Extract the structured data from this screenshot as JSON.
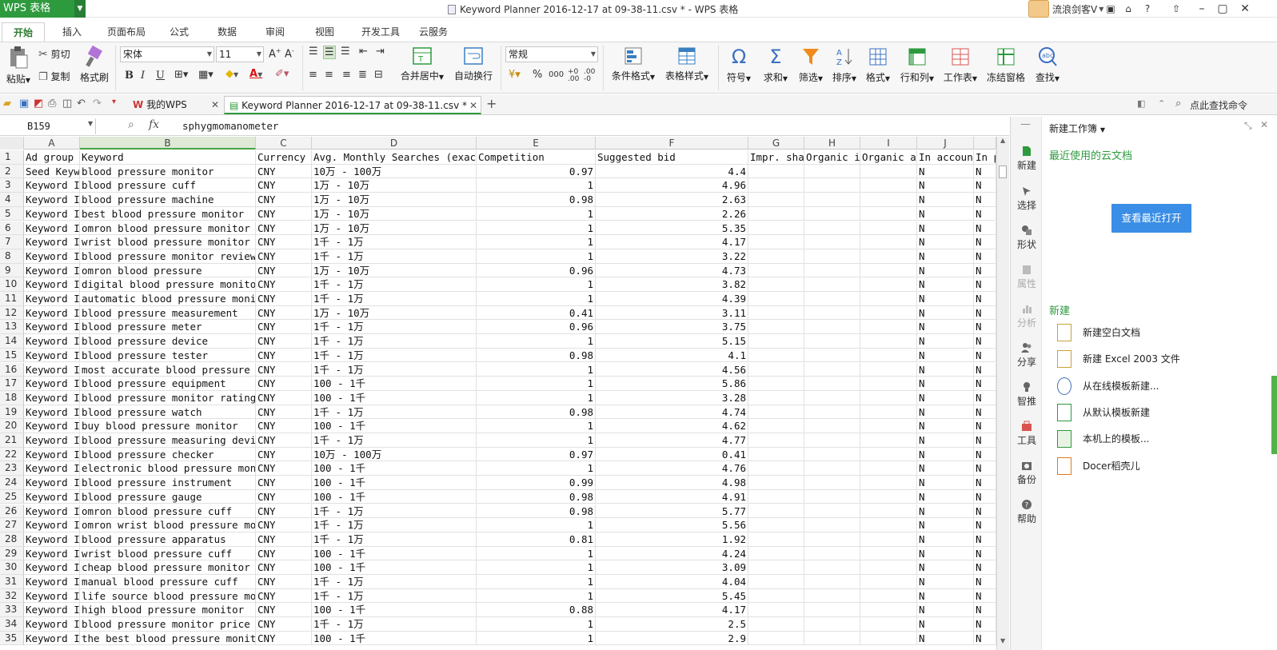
{
  "app": {
    "logo": "WPS 表格",
    "title": "Keyword Planner 2016-12-17 at 09-38-11.csv * - WPS 表格",
    "user": "流浪剑客V"
  },
  "ribbon_tabs": [
    "开始",
    "插入",
    "页面布局",
    "公式",
    "数据",
    "审阅",
    "视图",
    "开发工具",
    "云服务"
  ],
  "ribbon": {
    "paste": "粘贴",
    "cut": "剪切",
    "copy": "复制",
    "format_painter": "格式刷",
    "font_name": "宋体",
    "font_size": "11",
    "merge_center": "合并居中",
    "wrap_text": "自动换行",
    "number_format": "常规",
    "percent": "%",
    "comma": "000",
    "cond_format": "条件格式",
    "table_style": "表格样式",
    "symbol": "符号",
    "sum": "求和",
    "filter": "筛选",
    "sort": "排序",
    "format": "格式",
    "row_col": "行和列",
    "worksheet": "工作表",
    "freeze": "冻结窗格",
    "find": "查找"
  },
  "doc_tabs": {
    "my_wps": "我的WPS",
    "active": "Keyword Planner 2016-12-17 at 09-38-11.csv *",
    "search_cmd": "点此查找命令"
  },
  "formula_bar": {
    "cell_ref": "B159",
    "fx": "fx",
    "formula": "sphygmomanometer"
  },
  "columns": [
    "A",
    "B",
    "C",
    "D",
    "E",
    "F",
    "G",
    "H",
    "I",
    "J",
    ""
  ],
  "header_row": [
    "Ad group",
    "Keyword",
    "Currency",
    "Avg. Monthly Searches (exact match only)",
    "Competition",
    "Suggested bid",
    "Impr. share",
    "Organic impr. share",
    "Organic avg. position",
    "In account?",
    "In plan?"
  ],
  "rows": [
    [
      "Seed Keywords",
      "blood pressure monitor",
      "CNY",
      "10万 - 100万",
      "0.97",
      "4.4",
      "",
      "",
      "",
      "N",
      "N"
    ],
    [
      "Keyword Ideas",
      "blood pressure cuff",
      "CNY",
      "1万 - 10万",
      "1",
      "4.96",
      "",
      "",
      "",
      "N",
      "N"
    ],
    [
      "Keyword Ideas",
      "blood pressure machine",
      "CNY",
      "1万 - 10万",
      "0.98",
      "2.63",
      "",
      "",
      "",
      "N",
      "N"
    ],
    [
      "Keyword Ideas",
      "best blood pressure monitor",
      "CNY",
      "1万 - 10万",
      "1",
      "2.26",
      "",
      "",
      "",
      "N",
      "N"
    ],
    [
      "Keyword Ideas",
      "omron blood pressure monitor",
      "CNY",
      "1万 - 10万",
      "1",
      "5.35",
      "",
      "",
      "",
      "N",
      "N"
    ],
    [
      "Keyword Ideas",
      "wrist blood pressure monitor",
      "CNY",
      "1千 - 1万",
      "1",
      "4.17",
      "",
      "",
      "",
      "N",
      "N"
    ],
    [
      "Keyword Ideas",
      "blood pressure monitor reviews",
      "CNY",
      "1千 - 1万",
      "1",
      "3.22",
      "",
      "",
      "",
      "N",
      "N"
    ],
    [
      "Keyword Ideas",
      "omron blood pressure",
      "CNY",
      "1万 - 10万",
      "0.96",
      "4.73",
      "",
      "",
      "",
      "N",
      "N"
    ],
    [
      "Keyword Ideas",
      "digital blood pressure monitor",
      "CNY",
      "1千 - 1万",
      "1",
      "3.82",
      "",
      "",
      "",
      "N",
      "N"
    ],
    [
      "Keyword Ideas",
      "automatic blood pressure monitor",
      "CNY",
      "1千 - 1万",
      "1",
      "4.39",
      "",
      "",
      "",
      "N",
      "N"
    ],
    [
      "Keyword Ideas",
      "blood pressure measurement",
      "CNY",
      "1万 - 10万",
      "0.41",
      "3.11",
      "",
      "",
      "",
      "N",
      "N"
    ],
    [
      "Keyword Ideas",
      "blood pressure meter",
      "CNY",
      "1千 - 1万",
      "0.96",
      "3.75",
      "",
      "",
      "",
      "N",
      "N"
    ],
    [
      "Keyword Ideas",
      "blood pressure device",
      "CNY",
      "1千 - 1万",
      "1",
      "5.15",
      "",
      "",
      "",
      "N",
      "N"
    ],
    [
      "Keyword Ideas",
      "blood pressure tester",
      "CNY",
      "1千 - 1万",
      "0.98",
      "4.1",
      "",
      "",
      "",
      "N",
      "N"
    ],
    [
      "Keyword Ideas",
      "most accurate blood pressure monitor",
      "CNY",
      "1千 - 1万",
      "1",
      "4.56",
      "",
      "",
      "",
      "N",
      "N"
    ],
    [
      "Keyword Ideas",
      "blood pressure equipment",
      "CNY",
      "100 - 1千",
      "1",
      "5.86",
      "",
      "",
      "",
      "N",
      "N"
    ],
    [
      "Keyword Ideas",
      "blood pressure monitor ratings",
      "CNY",
      "100 - 1千",
      "1",
      "3.28",
      "",
      "",
      "",
      "N",
      "N"
    ],
    [
      "Keyword Ideas",
      "blood pressure watch",
      "CNY",
      "1千 - 1万",
      "0.98",
      "4.74",
      "",
      "",
      "",
      "N",
      "N"
    ],
    [
      "Keyword Ideas",
      "buy blood pressure monitor",
      "CNY",
      "100 - 1千",
      "1",
      "4.62",
      "",
      "",
      "",
      "N",
      "N"
    ],
    [
      "Keyword Ideas",
      "blood pressure measuring device",
      "CNY",
      "1千 - 1万",
      "1",
      "4.77",
      "",
      "",
      "",
      "N",
      "N"
    ],
    [
      "Keyword Ideas",
      "blood pressure checker",
      "CNY",
      "10万 - 100万",
      "0.97",
      "0.41",
      "",
      "",
      "",
      "N",
      "N"
    ],
    [
      "Keyword Ideas",
      "electronic blood pressure monitor",
      "CNY",
      "100 - 1千",
      "1",
      "4.76",
      "",
      "",
      "",
      "N",
      "N"
    ],
    [
      "Keyword Ideas",
      "blood pressure instrument",
      "CNY",
      "100 - 1千",
      "0.99",
      "4.98",
      "",
      "",
      "",
      "N",
      "N"
    ],
    [
      "Keyword Ideas",
      "blood pressure gauge",
      "CNY",
      "100 - 1千",
      "0.98",
      "4.91",
      "",
      "",
      "",
      "N",
      "N"
    ],
    [
      "Keyword Ideas",
      "omron blood pressure cuff",
      "CNY",
      "1千 - 1万",
      "0.98",
      "5.77",
      "",
      "",
      "",
      "N",
      "N"
    ],
    [
      "Keyword Ideas",
      "omron wrist blood pressure monitor",
      "CNY",
      "1千 - 1万",
      "1",
      "5.56",
      "",
      "",
      "",
      "N",
      "N"
    ],
    [
      "Keyword Ideas",
      "blood pressure apparatus",
      "CNY",
      "1千 - 1万",
      "0.81",
      "1.92",
      "",
      "",
      "",
      "N",
      "N"
    ],
    [
      "Keyword Ideas",
      "wrist blood pressure cuff",
      "CNY",
      "100 - 1千",
      "1",
      "4.24",
      "",
      "",
      "",
      "N",
      "N"
    ],
    [
      "Keyword Ideas",
      "cheap blood pressure monitor",
      "CNY",
      "100 - 1千",
      "1",
      "3.09",
      "",
      "",
      "",
      "N",
      "N"
    ],
    [
      "Keyword Ideas",
      "manual blood pressure cuff",
      "CNY",
      "1千 - 1万",
      "1",
      "4.04",
      "",
      "",
      "",
      "N",
      "N"
    ],
    [
      "Keyword Ideas",
      "life source blood pressure monitor",
      "CNY",
      "1千 - 1万",
      "1",
      "5.45",
      "",
      "",
      "",
      "N",
      "N"
    ],
    [
      "Keyword Ideas",
      "high blood pressure monitor",
      "CNY",
      "100 - 1千",
      "0.88",
      "4.17",
      "",
      "",
      "",
      "N",
      "N"
    ],
    [
      "Keyword Ideas",
      "blood pressure monitor price",
      "CNY",
      "1千 - 1万",
      "1",
      "2.5",
      "",
      "",
      "",
      "N",
      "N"
    ],
    [
      "Keyword Ideas",
      "the best blood pressure monitor",
      "CNY",
      "100 - 1千",
      "1",
      "2.9",
      "",
      "",
      "",
      "N",
      "N"
    ]
  ],
  "rail": [
    "新建",
    "选择",
    "形状",
    "属性",
    "分析",
    "分享",
    "智推",
    "工具",
    "备份",
    "帮助"
  ],
  "pane": {
    "title": "新建工作簿",
    "recent_heading": "最近使用的云文档",
    "open_recent": "查看最近打开",
    "new_heading": "新建",
    "new_items": [
      "新建空白文档",
      "新建 Excel 2003 文件",
      "从在线模板新建...",
      "从默认模板新建",
      "本机上的模板...",
      "Docer稻壳儿"
    ]
  },
  "colors": {
    "brand_green": "#2d9a3e",
    "button_blue": "#3a8ee6"
  }
}
